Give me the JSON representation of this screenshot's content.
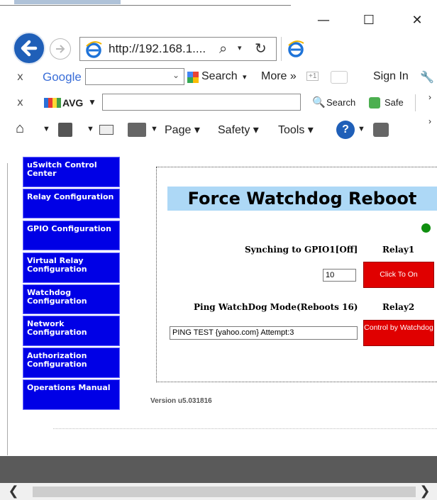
{
  "window": {
    "minimize_glyph": "—",
    "maximize_glyph": "☐",
    "close_glyph": "✕"
  },
  "nav": {
    "address": "http://192.168.1....",
    "search_glyph": "⌕",
    "refresh_glyph": "↻"
  },
  "google_toolbar": {
    "close": "x",
    "brand": "Google",
    "search_label": "Search",
    "more_label": "More »",
    "plus_badge": "+1",
    "signin_label": "Sign In"
  },
  "avg_toolbar": {
    "close": "x",
    "brand": "AVG",
    "search_label": "Search",
    "safe_label": "Safe"
  },
  "command_bar": {
    "page_label": "Page",
    "safety_label": "Safety",
    "tools_label": "Tools"
  },
  "sidebar": {
    "items": [
      {
        "label": "uSwitch Control Center"
      },
      {
        "label": "Relay Configuration"
      },
      {
        "label": "GPIO Configuration"
      },
      {
        "label": "Virtual Relay Configuration"
      },
      {
        "label": "Watchdog Configuration"
      },
      {
        "label": "Network Configuration"
      },
      {
        "label": "Authorization Configuration"
      },
      {
        "label": "Operations Manual"
      }
    ]
  },
  "main": {
    "title": "Force Watchdog Reboot",
    "status_color": "#0f8f0f",
    "relay1": {
      "status_text": "Synching to GPIO1[Off]",
      "heading": "Relay1",
      "input_value": "10",
      "button_label": "Click To On"
    },
    "relay2": {
      "status_text": "Ping WatchDog Mode(Reboots 16)",
      "heading": "Relay2",
      "field_value": "PING TEST {yahoo.com} Attempt:3",
      "button_label": "Control by Watchdog"
    },
    "version": "Version u5.031816"
  },
  "colors": {
    "nav_blue": "#0000e6",
    "relay_red": "#e00000",
    "title_band": "#add8f6"
  }
}
